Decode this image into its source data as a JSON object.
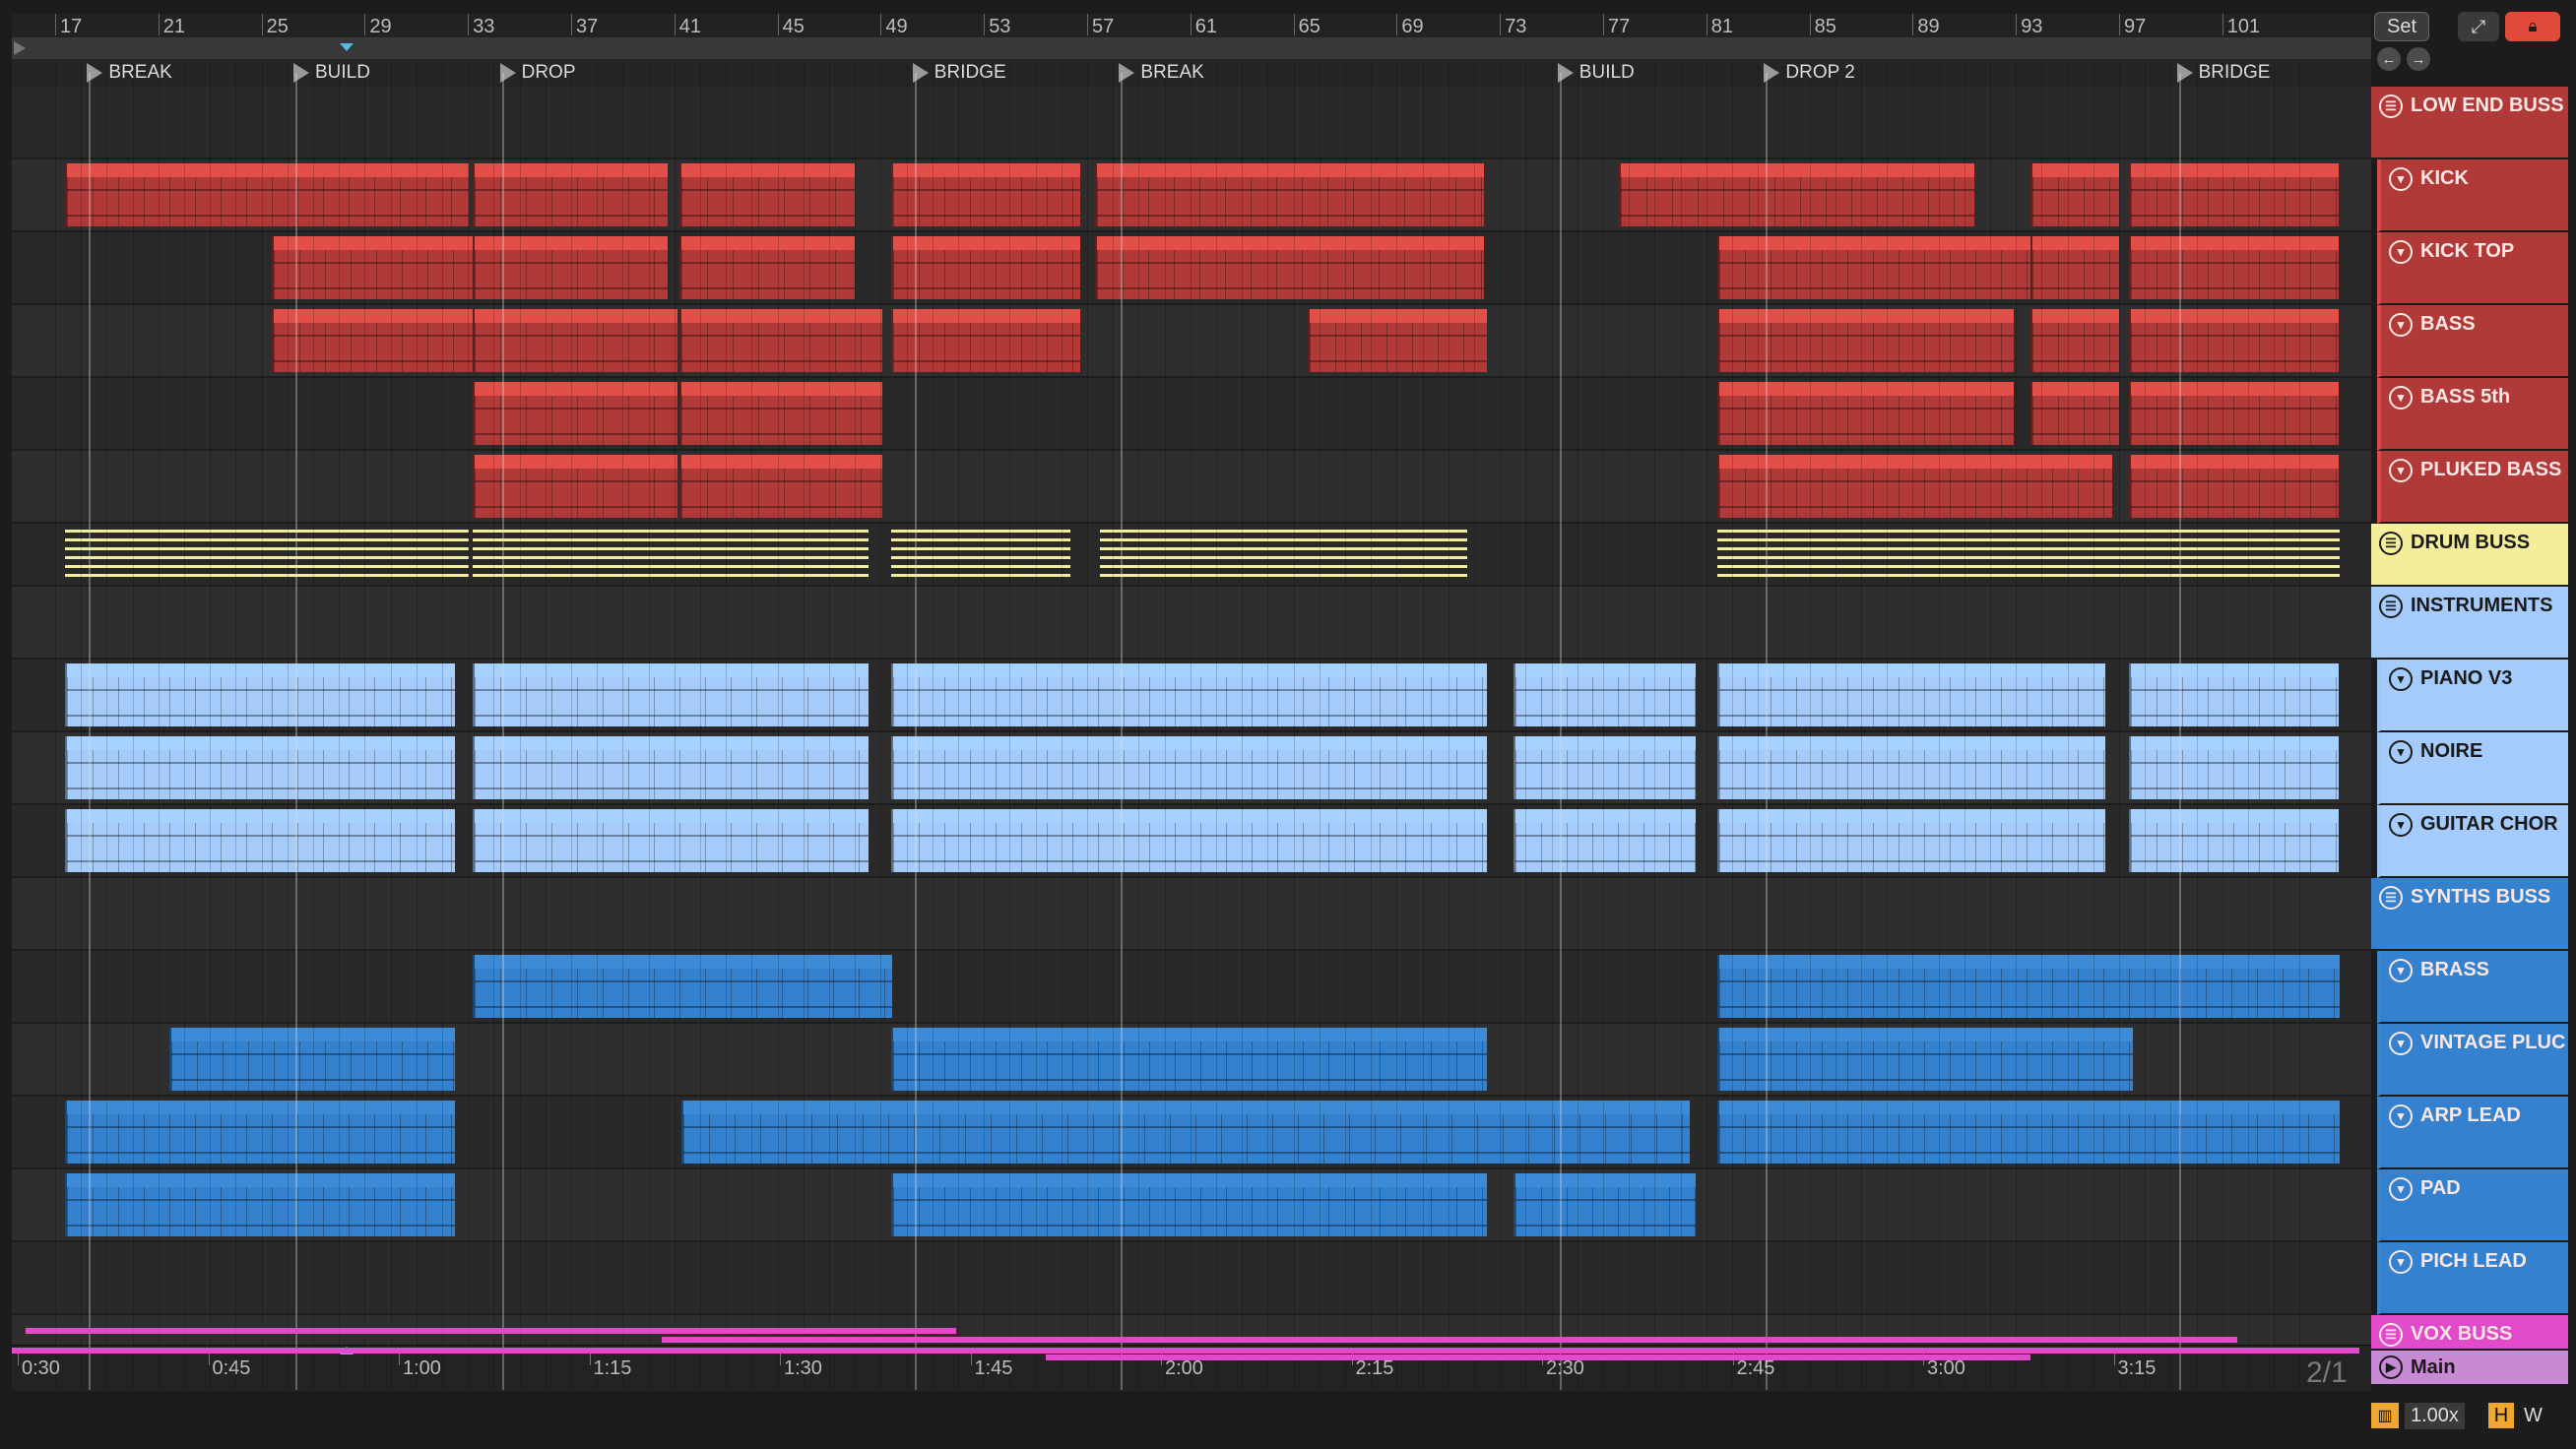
{
  "ruler": {
    "bars": [
      "17",
      "21",
      "25",
      "29",
      "33",
      "37",
      "41",
      "45",
      "49",
      "53",
      "57",
      "61",
      "65",
      "69",
      "73",
      "77",
      "81",
      "85",
      "89",
      "93",
      "97",
      "101"
    ]
  },
  "locators": [
    {
      "name": "BREAK"
    },
    {
      "name": "BUILD"
    },
    {
      "name": "DROP"
    },
    {
      "name": "BRIDGE"
    },
    {
      "name": "BREAK"
    },
    {
      "name": "BUILD"
    },
    {
      "name": "DROP 2"
    },
    {
      "name": "BRIDGE"
    }
  ],
  "time_ruler": {
    "labels": [
      "0:30",
      "0:45",
      "1:00",
      "1:15",
      "1:30",
      "1:45",
      "2:00",
      "2:15",
      "2:30",
      "2:45",
      "3:00",
      "3:15"
    ]
  },
  "controls": {
    "set_label": "Set",
    "expand_icon": "expand-arrows-icon",
    "lock_icon": "lock-icon",
    "nav_back_icon": "arrow-left-icon",
    "nav_forward_icon": "arrow-right-icon",
    "time_signature": "2/1",
    "zoom": "1.00x",
    "h_label": "H",
    "w_label": "W"
  },
  "colors": {
    "red": "#b13a38",
    "red_hdr": "#d74a45",
    "yellow": "#f4ee9a",
    "yellow_hdr": "#f7f39a",
    "lightblue": "#a4cbfa",
    "lightblue_hdr": "#9fc7f3",
    "blue": "#3381cf",
    "blue_hdr": "#3a84cc",
    "pink": "#e14ac9",
    "main": "#c88ad4"
  },
  "tracks": [
    {
      "name": "LOW END BUSS",
      "kind": "group",
      "color": "red"
    },
    {
      "name": "KICK",
      "kind": "track",
      "color": "red"
    },
    {
      "name": "KICK TOP",
      "kind": "track",
      "color": "red"
    },
    {
      "name": "BASS",
      "kind": "track",
      "color": "red"
    },
    {
      "name": "BASS 5th",
      "kind": "track",
      "color": "red"
    },
    {
      "name": "PLUKED BASS",
      "kind": "track",
      "color": "red"
    },
    {
      "name": "DRUM BUSS",
      "kind": "group",
      "color": "yellow"
    },
    {
      "name": "INSTRUMENTS",
      "kind": "group",
      "color": "lightblue"
    },
    {
      "name": "PIANO V3",
      "kind": "track",
      "color": "lightblue"
    },
    {
      "name": "NOIRE",
      "kind": "track",
      "color": "lightblue"
    },
    {
      "name": "GUITAR CHOR",
      "kind": "track",
      "color": "lightblue"
    },
    {
      "name": "SYNTHS BUSS",
      "kind": "group",
      "color": "blue"
    },
    {
      "name": "BRASS",
      "kind": "track",
      "color": "blue"
    },
    {
      "name": "VINTAGE PLUC",
      "kind": "track",
      "color": "blue"
    },
    {
      "name": "ARP LEAD",
      "kind": "track",
      "color": "blue"
    },
    {
      "name": "PAD",
      "kind": "track",
      "color": "blue"
    },
    {
      "name": "PICH LEAD",
      "kind": "track",
      "color": "blue"
    },
    {
      "name": "VOX BUSS",
      "kind": "group",
      "color": "pink"
    },
    {
      "name": "Main",
      "kind": "main",
      "color": "main"
    }
  ]
}
